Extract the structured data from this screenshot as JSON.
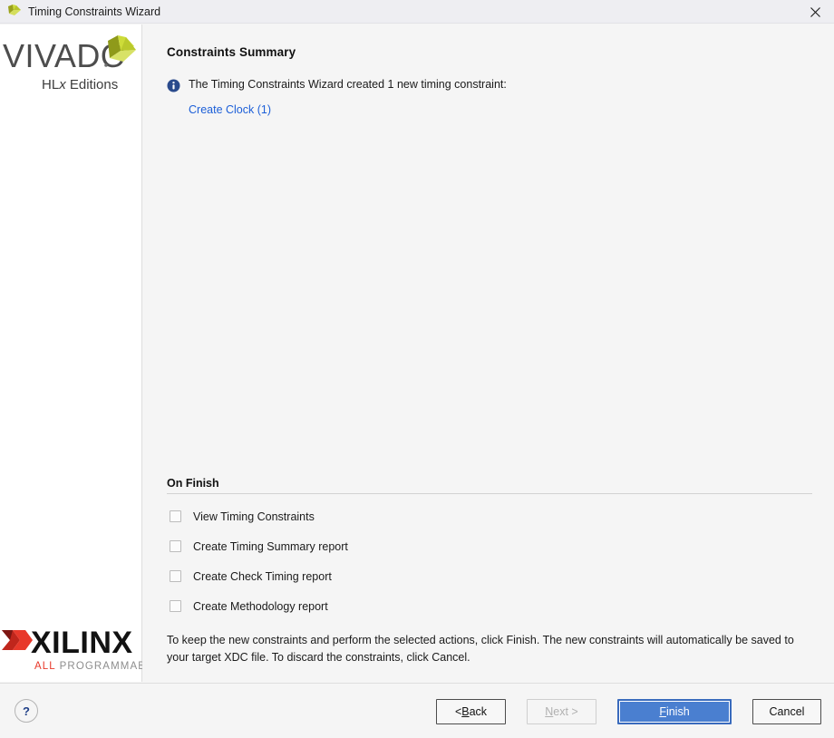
{
  "window": {
    "title": "Timing Constraints Wizard",
    "icon": "vivado-app-icon",
    "close_icon": "close-icon"
  },
  "sidebar": {
    "product_logo": {
      "name": "VIVADO",
      "wordmark": "VIVADO",
      "tagline": "HLx Editions",
      "accent_color": "#cddc39"
    },
    "vendor_logo": {
      "name": "XILINX",
      "wordmark": "XILINX",
      "tagline_accent": "ALL",
      "tagline_rest": "PROGRAMMABLE.",
      "accent_color": "#e8382a"
    }
  },
  "main": {
    "page_title": "Constraints Summary",
    "info": {
      "icon": "info-icon",
      "message": "The Timing Constraints Wizard created 1 new timing constraint:",
      "link_label": "Create Clock (1)",
      "link_color": "#1c5fd8"
    },
    "on_finish": {
      "section_label": "On Finish",
      "options": [
        {
          "label": "View Timing Constraints",
          "checked": false
        },
        {
          "label": "Create Timing Summary report",
          "checked": false
        },
        {
          "label": "Create Check Timing report",
          "checked": false
        },
        {
          "label": "Create Methodology report",
          "checked": false
        }
      ]
    },
    "footer_text": "To keep the new constraints and perform the selected actions, click Finish. The new constraints will automatically be saved to your target XDC file. To discard the constraints, click Cancel."
  },
  "buttons": {
    "help": "?",
    "back_prefix": "< ",
    "back_mnemonic": "B",
    "back_suffix": "ack",
    "next_mnemonic": "N",
    "next_suffix": "ext >",
    "finish_mnemonic": "F",
    "finish_suffix": "inish",
    "cancel": "Cancel",
    "finish_color": "#4a7fd0"
  }
}
